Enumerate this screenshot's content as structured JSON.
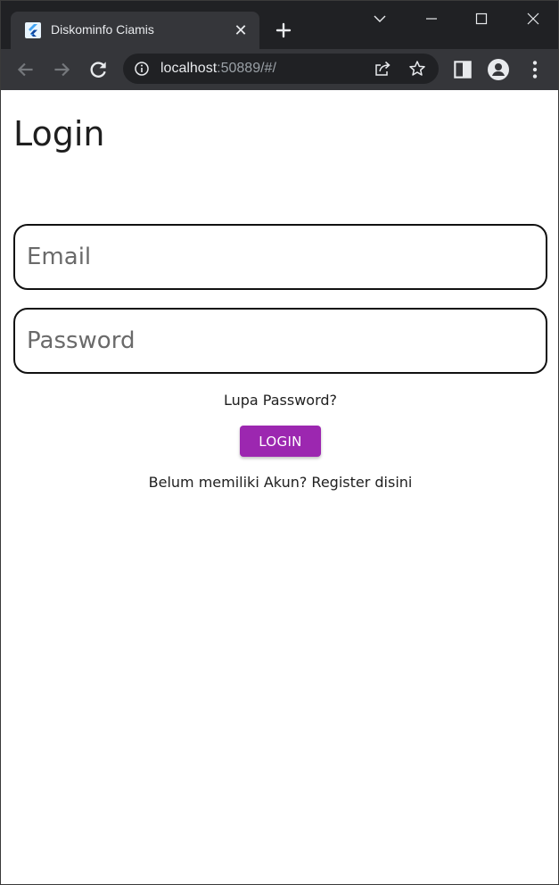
{
  "browser": {
    "tab": {
      "title": "Diskominfo Ciamis",
      "close_glyph": "✕"
    },
    "address": {
      "host": "localhost",
      "rest": ":50889/#/"
    }
  },
  "page": {
    "title": "Login",
    "email": {
      "placeholder": "Email",
      "value": ""
    },
    "password": {
      "placeholder": "Password",
      "value": ""
    },
    "forgot_label": "Lupa Password?",
    "login_label": "LOGIN",
    "register_label": "Belum memiliki Akun? Register disini"
  },
  "colors": {
    "accent": "#9c27b0",
    "chrome_dark": "#202124",
    "chrome_toolbar": "#35363a"
  },
  "icons": [
    "flutter-icon",
    "close-icon",
    "plus-icon",
    "chevron-down-icon",
    "minimize-icon",
    "maximize-icon",
    "close-window-icon",
    "back-icon",
    "forward-icon",
    "reload-icon",
    "info-icon",
    "share-icon",
    "star-icon",
    "side-panel-icon",
    "profile-icon",
    "menu-icon"
  ]
}
